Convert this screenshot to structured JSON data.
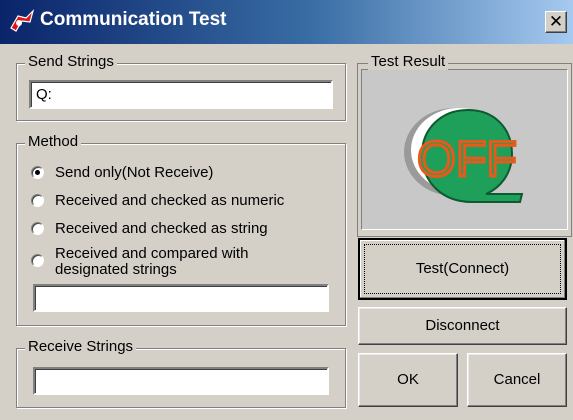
{
  "window": {
    "title": "Communication Test",
    "close_glyph": "✕",
    "app_icon": "application-icon"
  },
  "send": {
    "group_label": "Send Strings",
    "value": "Q:"
  },
  "method": {
    "group_label": "Method",
    "options": [
      {
        "label": "Send only(Not Receive)",
        "checked": true
      },
      {
        "label": "Received and checked as numeric",
        "checked": false
      },
      {
        "label": "Received and checked as string",
        "checked": false
      },
      {
        "label": "Received and compared with designated strings",
        "checked": false
      }
    ],
    "designated_value": ""
  },
  "receive": {
    "group_label": "Receive Strings",
    "value": ""
  },
  "result": {
    "group_label": "Test Result",
    "indicator_text": "OFF",
    "indicator_icon": "off-status-bubble-icon",
    "colors": {
      "bubble": "#1e9f5a",
      "text": "#e85a1c",
      "shadow": "#9a9a9a"
    }
  },
  "buttons": {
    "test": "Test(Connect)",
    "disconnect": "Disconnect",
    "ok": "OK",
    "cancel": "Cancel"
  }
}
